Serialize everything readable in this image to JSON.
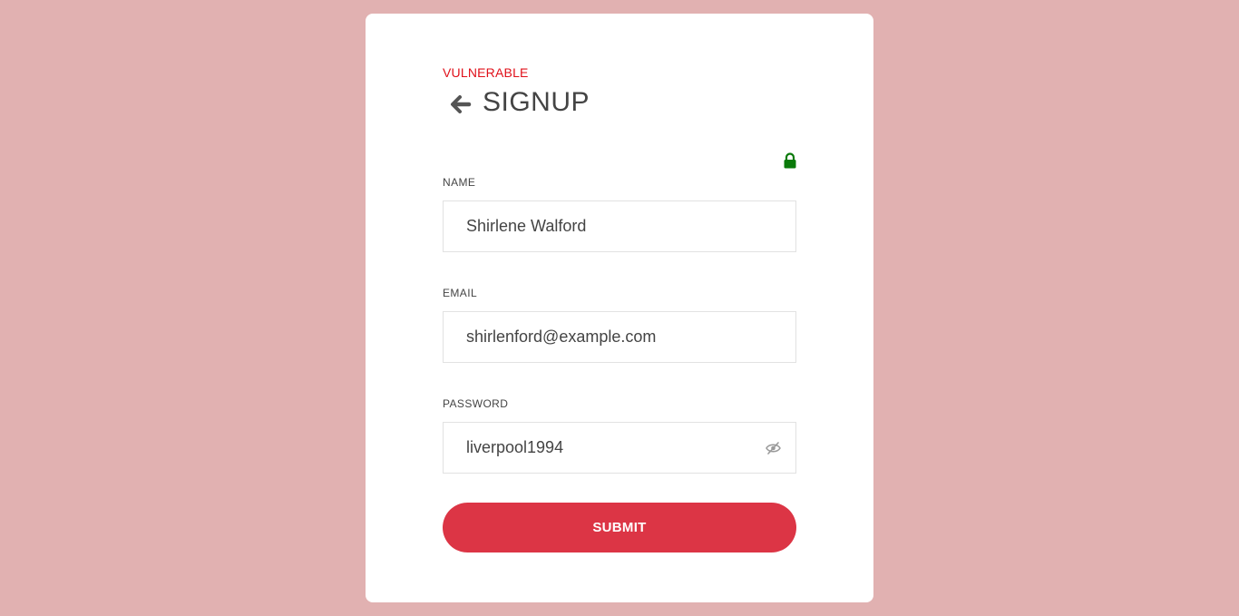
{
  "colors": {
    "page_background": "#e1b1b1",
    "card_background": "#ffffff",
    "status_text": "#e0101a",
    "lock_icon": "#0a7a0a",
    "submit_background": "#dc3545"
  },
  "header": {
    "status": "VULNERABLE",
    "back_icon": "arrow-left-icon",
    "title": "SIGNUP",
    "lock_icon": "lock-icon"
  },
  "form": {
    "name": {
      "label": "NAME",
      "value": "Shirlene Walford"
    },
    "email": {
      "label": "EMAIL",
      "value": "shirlenford@example.com"
    },
    "password": {
      "label": "PASSWORD",
      "value": "liverpool1994",
      "toggle_icon": "eye-slash-icon"
    },
    "submit_label": "SUBMIT"
  }
}
